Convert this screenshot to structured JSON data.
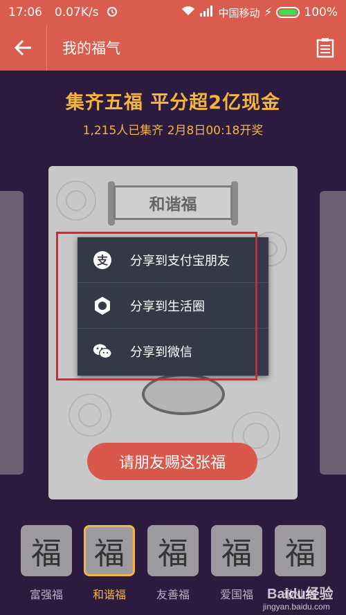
{
  "status": {
    "time": "17:06",
    "speed": "0.07K/s",
    "carrier": "中国移动",
    "battery": "100%"
  },
  "appbar": {
    "back_icon": "arrow-left-icon",
    "title": "我的福气",
    "right_icon": "clipboard-icon"
  },
  "banner": {
    "headline": "集齐五福 平分超2亿现金",
    "subline": "1,215人已集齐 2月8日00:18开奖"
  },
  "card": {
    "name": "和谐福",
    "button_label": "请朋友赐这张福"
  },
  "share_menu": {
    "items": [
      {
        "icon": "alipay-icon",
        "label": "分享到支付宝朋友"
      },
      {
        "icon": "aperture-icon",
        "label": "分享到生活圈"
      },
      {
        "icon": "wechat-icon",
        "label": "分享到微信"
      }
    ]
  },
  "tray": {
    "items": [
      {
        "glyph": "福",
        "label": "富强福"
      },
      {
        "glyph": "福",
        "label": "和谐福"
      },
      {
        "glyph": "福",
        "label": "友善福"
      },
      {
        "glyph": "福",
        "label": "爱国福"
      },
      {
        "glyph": "福",
        "label": "敬业福"
      }
    ],
    "selected_index": 1
  },
  "watermark": {
    "text": "Baidu经验",
    "url": "jingyan.baidu.com"
  },
  "colors": {
    "accent": "#d95c4f",
    "gold": "#f4b63a",
    "background": "#2d1b3f",
    "highlight": "#e5202a"
  }
}
